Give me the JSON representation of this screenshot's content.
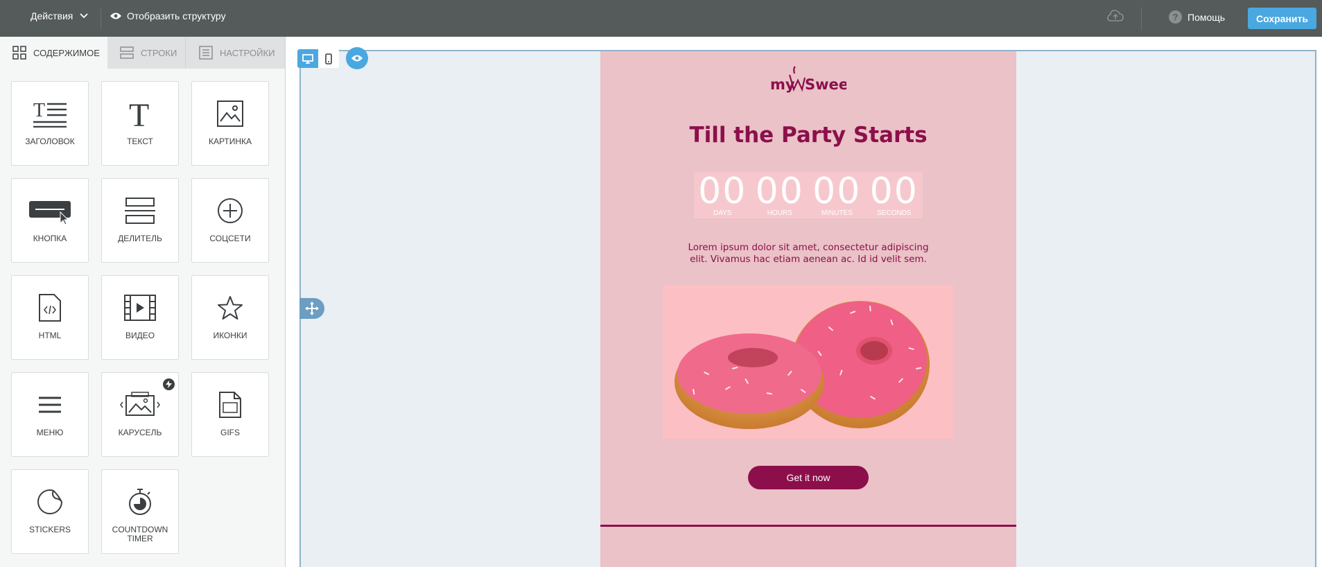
{
  "topbar": {
    "actions_label": "Действия",
    "structure_label": "Отобразить структуру",
    "help_label": "Помощь",
    "save_label": "Сохранить"
  },
  "sidebar": {
    "tabs": [
      {
        "label": "Содержимое",
        "icon": "grid-icon",
        "active": true
      },
      {
        "label": "Строки",
        "icon": "rows-icon",
        "active": false
      },
      {
        "label": "Настройки",
        "icon": "settings-list-icon",
        "active": false
      }
    ],
    "blocks": [
      {
        "label": "Заголовок",
        "icon": "heading-icon"
      },
      {
        "label": "Текст",
        "icon": "text-icon"
      },
      {
        "label": "Картинка",
        "icon": "image-icon"
      },
      {
        "label": "Кнопка",
        "icon": "button-icon"
      },
      {
        "label": "Делитель",
        "icon": "divider-icon"
      },
      {
        "label": "Соцсети",
        "icon": "social-icon"
      },
      {
        "label": "HTML",
        "icon": "html-icon"
      },
      {
        "label": "Видео",
        "icon": "video-icon"
      },
      {
        "label": "Иконки",
        "icon": "star-icon"
      },
      {
        "label": "Меню",
        "icon": "menu-icon"
      },
      {
        "label": "Карусель",
        "icon": "carousel-icon"
      },
      {
        "label": "GIFs",
        "icon": "gif-icon"
      },
      {
        "label": "Stickers",
        "icon": "sticker-icon"
      },
      {
        "label": "Countdown Timer",
        "icon": "stopwatch-icon"
      }
    ]
  },
  "email": {
    "logo_text": "my Sweet",
    "title": "Till the Party Starts",
    "countdown": [
      {
        "value": "00",
        "label": "Days"
      },
      {
        "value": "00",
        "label": "Hours"
      },
      {
        "value": "00",
        "label": "Minutes"
      },
      {
        "value": "00",
        "label": "Seconds"
      }
    ],
    "body_text": "Lorem ipsum dolor sit amet, consectetur adipiscing elit. Vivamus hac etiam aenean ac. Id id velit sem.",
    "cta_label": "Get it now",
    "colors": {
      "brand": "#8c0f4b",
      "background": "#eac2c7"
    }
  },
  "colors": {
    "accent": "#4aa8e0",
    "topbar": "#555a5b"
  }
}
